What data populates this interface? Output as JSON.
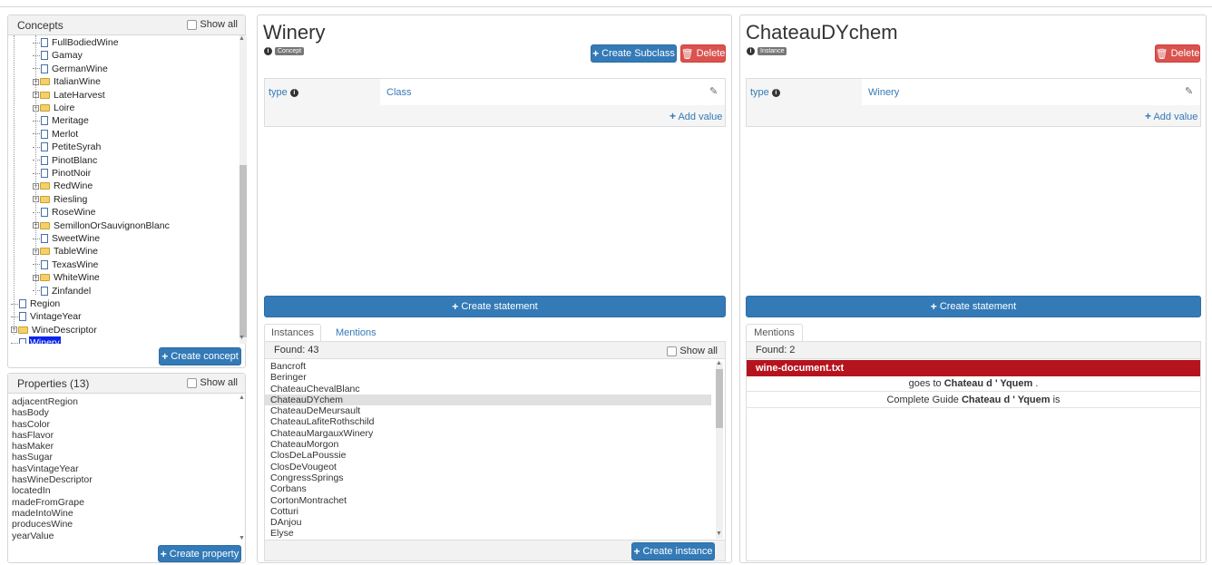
{
  "concepts": {
    "title": "Concepts",
    "show_all": "Show all",
    "create_button": "Create concept",
    "tree": [
      {
        "label": "FullBodiedWine",
        "kind": "file",
        "level": 2
      },
      {
        "label": "Gamay",
        "kind": "file",
        "level": 2
      },
      {
        "label": "GermanWine",
        "kind": "file",
        "level": 2
      },
      {
        "label": "ItalianWine",
        "kind": "folder",
        "level": 2
      },
      {
        "label": "LateHarvest",
        "kind": "folder",
        "level": 2
      },
      {
        "label": "Loire",
        "kind": "folder",
        "level": 2
      },
      {
        "label": "Meritage",
        "kind": "file",
        "level": 2
      },
      {
        "label": "Merlot",
        "kind": "file",
        "level": 2
      },
      {
        "label": "PetiteSyrah",
        "kind": "file",
        "level": 2
      },
      {
        "label": "PinotBlanc",
        "kind": "file",
        "level": 2
      },
      {
        "label": "PinotNoir",
        "kind": "file",
        "level": 2
      },
      {
        "label": "RedWine",
        "kind": "folder",
        "level": 2
      },
      {
        "label": "Riesling",
        "kind": "folder",
        "level": 2
      },
      {
        "label": "RoseWine",
        "kind": "file",
        "level": 2
      },
      {
        "label": "SemillonOrSauvignonBlanc",
        "kind": "folder",
        "level": 2
      },
      {
        "label": "SweetWine",
        "kind": "file",
        "level": 2
      },
      {
        "label": "TableWine",
        "kind": "folder",
        "level": 2
      },
      {
        "label": "TexasWine",
        "kind": "file",
        "level": 2
      },
      {
        "label": "WhiteWine",
        "kind": "folder",
        "level": 2
      },
      {
        "label": "Zinfandel",
        "kind": "file",
        "level": 2
      },
      {
        "label": "Region",
        "kind": "file",
        "level": 0
      },
      {
        "label": "VintageYear",
        "kind": "file",
        "level": 0
      },
      {
        "label": "WineDescriptor",
        "kind": "folder",
        "level": 0
      },
      {
        "label": "Winery",
        "kind": "file",
        "level": 0,
        "selected": true
      }
    ]
  },
  "properties": {
    "title": "Properties (13)",
    "show_all": "Show all",
    "create_button": "Create property",
    "items": [
      "adjacentRegion",
      "hasBody",
      "hasColor",
      "hasFlavor",
      "hasMaker",
      "hasSugar",
      "hasVintageYear",
      "hasWineDescriptor",
      "locatedIn",
      "madeFromGrape",
      "madeIntoWine",
      "producesWine",
      "yearValue"
    ]
  },
  "concept_panel": {
    "title": "Winery",
    "badge": "Concept",
    "create_subclass": "Create Subclass",
    "delete": "Delete",
    "statement": {
      "predicate": "type",
      "value": "Class"
    },
    "add_value": "Add value",
    "create_statement": "Create statement",
    "tabs": [
      "Instances",
      "Mentions"
    ],
    "found": "Found: 43",
    "show_all": "Show all",
    "instances": [
      "Bancroft",
      "Beringer",
      "ChateauChevalBlanc",
      "ChateauDYchem",
      "ChateauDeMeursault",
      "ChateauLafiteRothschild",
      "ChateauMargauxWinery",
      "ChateauMorgon",
      "ClosDeLaPoussie",
      "ClosDeVougeot",
      "CongressSprings",
      "Corbans",
      "CortonMontrachet",
      "Cotturi",
      "DAnjou",
      "Elyse"
    ],
    "selected_instance": "ChateauDYchem",
    "create_instance": "Create instance"
  },
  "instance_panel": {
    "title": "ChateauDYchem",
    "badge": "Instance",
    "delete": "Delete",
    "statement": {
      "predicate": "type",
      "value": "Winery"
    },
    "add_value": "Add value",
    "create_statement": "Create statement",
    "tab": "Mentions",
    "found": "Found: 2",
    "document": "wine-document.txt",
    "mentions": [
      {
        "before": "goes to ",
        "bold": "Chateau d ' Yquem",
        "after": " ."
      },
      {
        "before": "Complete Guide ",
        "bold": "Chateau d ' Yquem",
        "after": " is"
      }
    ]
  },
  "colors": {
    "primary": "#337ab7",
    "danger": "#d9534f",
    "mention": "#b5141e",
    "selection": "#0b25ea"
  }
}
